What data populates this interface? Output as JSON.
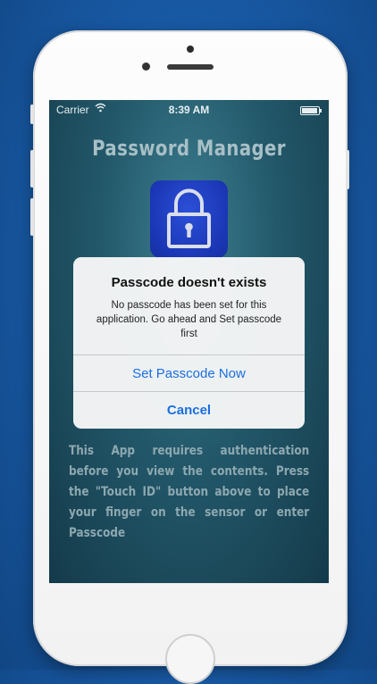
{
  "status_bar": {
    "carrier": "Carrier",
    "wifi_icon": "wifi-icon",
    "time": "8:39 AM",
    "battery_icon": "battery-icon"
  },
  "app": {
    "title": "Password Manager",
    "lock_icon": "padlock-icon",
    "info": "This App requires authentication before you view the contents. Press the \"Touch ID\" button above to place your finger on the sensor or enter Passcode"
  },
  "alert": {
    "title": "Passcode doesn't exists",
    "message": "No passcode has been set for this application. Go ahead and Set passcode first",
    "primary_button": "Set Passcode Now",
    "cancel_button": "Cancel"
  },
  "colors": {
    "background": "#17569f",
    "alert_button": "#1a6fe0",
    "lock_tile": "#1b37b6"
  }
}
